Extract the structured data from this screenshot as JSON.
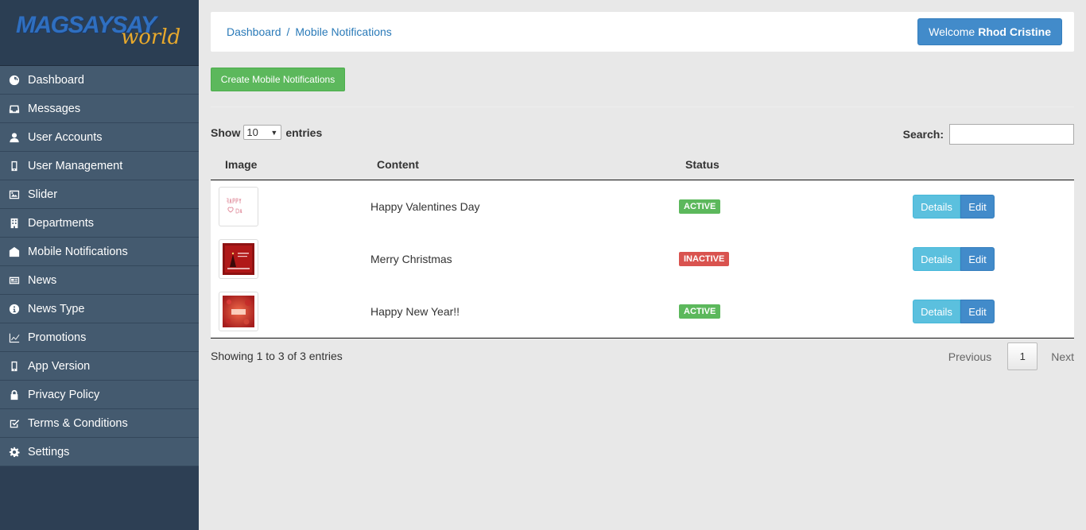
{
  "brand": {
    "name": "MAGSAYSAY",
    "sub": "world"
  },
  "sidebar": {
    "items": [
      {
        "label": "Dashboard",
        "icon": "dashboard-icon"
      },
      {
        "label": "Messages",
        "icon": "inbox-icon"
      },
      {
        "label": "User Accounts",
        "icon": "user-icon"
      },
      {
        "label": "User Management",
        "icon": "mobile-icon"
      },
      {
        "label": "Slider",
        "icon": "image-icon"
      },
      {
        "label": "Departments",
        "icon": "building-icon"
      },
      {
        "label": "Mobile Notifications",
        "icon": "envelope-open-icon"
      },
      {
        "label": "News",
        "icon": "newspaper-icon"
      },
      {
        "label": "News Type",
        "icon": "info-icon"
      },
      {
        "label": "Promotions",
        "icon": "line-chart-icon"
      },
      {
        "label": "App Version",
        "icon": "mobile-icon"
      },
      {
        "label": "Privacy Policy",
        "icon": "lock-icon"
      },
      {
        "label": "Terms & Conditions",
        "icon": "edit-check-icon"
      },
      {
        "label": "Settings",
        "icon": "gear-icon"
      }
    ]
  },
  "header": {
    "breadcrumb": [
      "Dashboard",
      "Mobile Notifications"
    ],
    "separator": "/",
    "welcome_prefix": "Welcome",
    "user_name": "Rhod Cristine"
  },
  "toolbar": {
    "create_label": "Create Mobile Notifications"
  },
  "table_controls": {
    "show_label": "Show",
    "page_size": "10",
    "entries_label": "entries",
    "search_label": "Search:",
    "search_value": ""
  },
  "table": {
    "columns": [
      "Image",
      "Content",
      "Status"
    ],
    "rows": [
      {
        "content": "Happy Valentines Day",
        "status": "ACTIVE",
        "details": "Details",
        "edit": "Edit"
      },
      {
        "content": "Merry Christmas",
        "status": "INACTIVE",
        "details": "Details",
        "edit": "Edit"
      },
      {
        "content": "Happy New Year!!",
        "status": "ACTIVE",
        "details": "Details",
        "edit": "Edit"
      }
    ]
  },
  "footer": {
    "info": "Showing 1 to 3 of 3 entries",
    "previous": "Previous",
    "current_page": "1",
    "next": "Next"
  },
  "colors": {
    "sidebar_bg": "#2d3f54",
    "nav_item_bg": "#445a6f",
    "primary": "#428bca",
    "success": "#5cb85c",
    "danger": "#d9534f",
    "info": "#5bc0de"
  }
}
